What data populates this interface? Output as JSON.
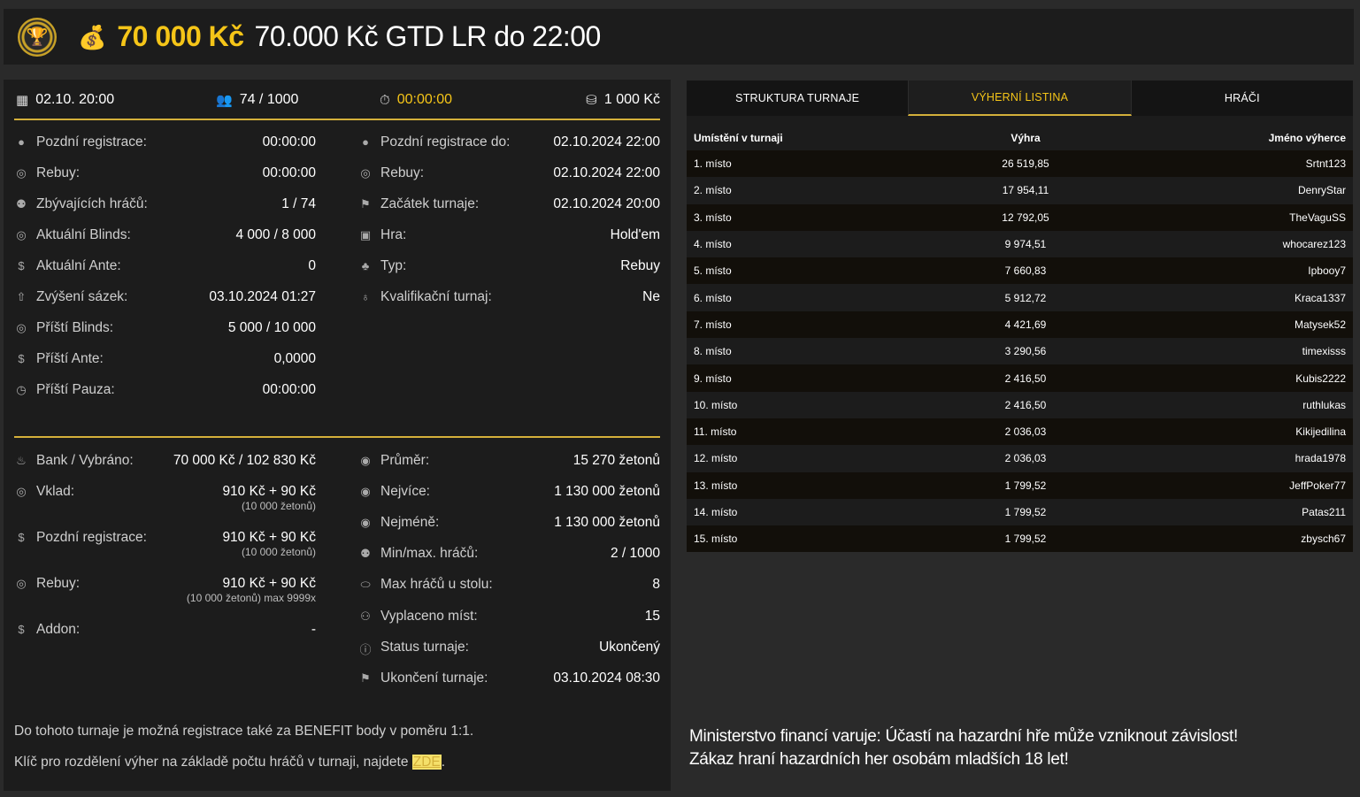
{
  "header": {
    "prize": "70 000 Kč",
    "title": "70.000 Kč GTD LR do 22:00"
  },
  "topbar": {
    "date": "02.10. 20:00",
    "players": "74 / 1000",
    "timer": "00:00:00",
    "buyin": "1 000 Kč"
  },
  "left_info": [
    {
      "icon": "user-icon",
      "label": "Pozdní registrace:",
      "value": "00:00:00"
    },
    {
      "icon": "chips-icon",
      "label": "Rebuy:",
      "value": "00:00:00"
    },
    {
      "icon": "users-icon",
      "label": "Zbývajících hráčů:",
      "value": "1 / 74"
    },
    {
      "icon": "chips-icon",
      "label": "Aktuální Blinds:",
      "value": "4 000 / 8 000"
    },
    {
      "icon": "coin-icon",
      "label": "Aktuální Ante:",
      "value": "0"
    },
    {
      "icon": "arrow-up-icon",
      "label": "Zvýšení sázek:",
      "value": "03.10.2024 01:27"
    },
    {
      "icon": "chips-icon",
      "label": "Příští Blinds:",
      "value": "5 000 / 10 000"
    },
    {
      "icon": "coin-icon",
      "label": "Příští Ante:",
      "value": "0,0000"
    },
    {
      "icon": "clock-icon",
      "label": "Příští Pauza:",
      "value": "00:00:00"
    }
  ],
  "right_info": [
    {
      "icon": "user-icon",
      "label": "Pozdní registrace do:",
      "value": "02.10.2024 22:00"
    },
    {
      "icon": "chips-icon",
      "label": "Rebuy:",
      "value": "02.10.2024 22:00"
    },
    {
      "icon": "flag-icon",
      "label": "Začátek turnaje:",
      "value": "02.10.2024 20:00"
    },
    {
      "icon": "cards-icon",
      "label": "Hra:",
      "value": "Hold'em"
    },
    {
      "icon": "suits-icon",
      "label": "Typ:",
      "value": "Rebuy"
    },
    {
      "icon": "medal-icon",
      "label": "Kvalifikační turnaj:",
      "value": "Ne"
    }
  ],
  "bank_info": [
    {
      "icon": "bag-icon",
      "label": "Bank / Vybráno:",
      "value": "70 000 Kč / 102 830 Kč",
      "sub": ""
    },
    {
      "icon": "chips-icon",
      "label": "Vklad:",
      "value": "910 Kč + 90 Kč",
      "sub": "(10 000 žetonů)"
    },
    {
      "icon": "coin-icon",
      "label": "Pozdní registrace:",
      "value": "910 Kč + 90 Kč",
      "sub": "(10 000 žetonů)"
    },
    {
      "icon": "chips-icon",
      "label": "Rebuy:",
      "value": "910 Kč + 90 Kč",
      "sub": "(10 000 žetonů) max 9999x"
    },
    {
      "icon": "coin-icon",
      "label": "Addon:",
      "value": "-",
      "sub": ""
    }
  ],
  "stats_info": [
    {
      "icon": "chip-icon",
      "label": "Průměr:",
      "value": "15 270 žetonů"
    },
    {
      "icon": "chip-icon",
      "label": "Nejvíce:",
      "value": "1 130 000 žetonů"
    },
    {
      "icon": "chip-icon",
      "label": "Nejméně:",
      "value": "1 130 000 žetonů"
    },
    {
      "icon": "users-icon",
      "label": "Min/max. hráčů:",
      "value": "2 / 1000"
    },
    {
      "icon": "table-icon",
      "label": "Max hráčů u stolu:",
      "value": "8"
    },
    {
      "icon": "payout-icon",
      "label": "Vyplaceno míst:",
      "value": "15"
    },
    {
      "icon": "info-icon",
      "label": "Status turnaje:",
      "value": "Ukončený"
    },
    {
      "icon": "flag-icon",
      "label": "Ukončení turnaje:",
      "value": "03.10.2024 08:30"
    }
  ],
  "notes": {
    "benefit": "Do tohoto turnaje je možná registrace také za BENEFIT body v poměru 1:1.",
    "key_prefix": "Klíč pro rozdělení výher na základě počtu hráčů v turnaji, najdete ",
    "key_link": "ZDE",
    "key_suffix": "."
  },
  "tabs": [
    {
      "label": "STRUKTURA TURNAJE",
      "active": false
    },
    {
      "label": "VÝHERNÍ LISTINA",
      "active": true
    },
    {
      "label": "HRÁČI",
      "active": false
    }
  ],
  "payout_table": {
    "headers": [
      "Umístění v turnaji",
      "Výhra",
      "Jméno výherce"
    ],
    "rows": [
      [
        "1. místo",
        "26 519,85",
        "Srtnt123"
      ],
      [
        "2. místo",
        "17 954,11",
        "DenryStar"
      ],
      [
        "3. místo",
        "12 792,05",
        "TheVaguSS"
      ],
      [
        "4. místo",
        "9 974,51",
        "whocarez123"
      ],
      [
        "5. místo",
        "7 660,83",
        "Ipbooy7"
      ],
      [
        "6. místo",
        "5 912,72",
        "Kraca1337"
      ],
      [
        "7. místo",
        "4 421,69",
        "Matysek52"
      ],
      [
        "8. místo",
        "3 290,56",
        "timexisss"
      ],
      [
        "9. místo",
        "2 416,50",
        "Kubis2222"
      ],
      [
        "10. místo",
        "2 416,50",
        "ruthlukas"
      ],
      [
        "11. místo",
        "2 036,03",
        "Kikijedilina"
      ],
      [
        "12. místo",
        "2 036,03",
        "hrada1978"
      ],
      [
        "13. místo",
        "1 799,52",
        "JeffPoker77"
      ],
      [
        "14. místo",
        "1 799,52",
        "Patas211"
      ],
      [
        "15. místo",
        "1 799,52",
        "zbysch67"
      ]
    ]
  },
  "warning": {
    "line1": "Ministerstvo financí varuje: Účastí na hazardní hře může vzniknout závislost!",
    "line2": "Zákaz hraní hazardních her osobám mladších 18 let!"
  }
}
